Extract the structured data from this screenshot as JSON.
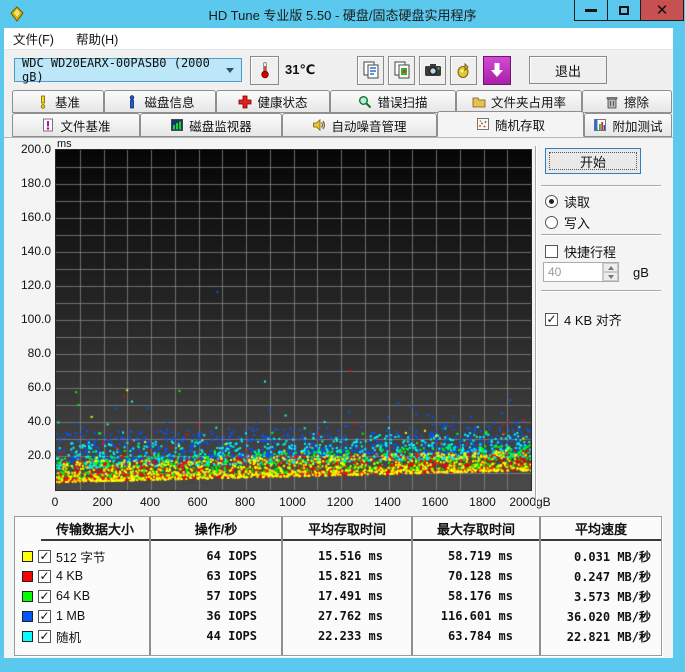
{
  "window": {
    "title": "HD Tune 专业版 5.50 - 硬盘/固态硬盘实用程序"
  },
  "menu": {
    "items": [
      "文件(F)",
      "帮助(H)"
    ]
  },
  "toolbar": {
    "drive": "WDC WD20EARX-00PASB0 (2000 gB)",
    "temperature": "31℃",
    "exit": "退出"
  },
  "tabs": {
    "row1": [
      {
        "label": "基准"
      },
      {
        "label": "磁盘信息"
      },
      {
        "label": "健康状态"
      },
      {
        "label": "错误扫描"
      },
      {
        "label": "文件夹占用率"
      },
      {
        "label": "擦除"
      }
    ],
    "row2": [
      {
        "label": "文件基准"
      },
      {
        "label": "磁盘监视器"
      },
      {
        "label": "自动噪音管理"
      },
      {
        "label": "随机存取"
      },
      {
        "label": "附加测试"
      }
    ],
    "active": "随机存取"
  },
  "panel": {
    "start": "开始",
    "read": "读取",
    "read_selected": true,
    "write": "写入",
    "write_selected": false,
    "short_stroke": "快捷行程",
    "short_stroke_checked": false,
    "short_stroke_value": "40",
    "short_stroke_unit": "gB",
    "align": "4 KB 对齐",
    "align_checked": true
  },
  "table": {
    "headers": [
      "传输数据大小",
      "操作/秒",
      "平均存取时间",
      "最大存取时间",
      "平均速度"
    ]
  },
  "chart_data": {
    "type": "scatter",
    "title": "",
    "xlabel": "gB",
    "ylabel": "ms",
    "xlim": [
      0,
      2000
    ],
    "ylim": [
      0,
      200
    ],
    "x_tick_values": [
      0,
      200,
      400,
      600,
      800,
      1000,
      1200,
      1400,
      1600,
      1800,
      2000
    ],
    "x_tick_labels": [
      "0",
      "200",
      "400",
      "600",
      "800",
      "1000",
      "1200",
      "1400",
      "1600",
      "1800",
      "2000gB"
    ],
    "y_tick_values": [
      20,
      40,
      60,
      80,
      100,
      120,
      140,
      160,
      180,
      200
    ],
    "x_grid_step": 100,
    "y_grid_step": 10,
    "grid": true,
    "legend_position": "bottom-table",
    "bg_top": "#060606",
    "bg_bottom": "#4a4a4a",
    "grid_color": "#8a8a8a",
    "draw_order": [
      3,
      4,
      2,
      1,
      0
    ],
    "series": [
      {
        "label": "512 字节",
        "color": "#ffff00",
        "checked": true,
        "iops": "64 IOPS",
        "avg_access": "15.516 ms",
        "max_access": "58.719 ms",
        "avg_speed": "0.031 MB/秒",
        "gen": {
          "seed": 11,
          "count": 1000,
          "base": 4.5,
          "rise": 7,
          "noise": 12,
          "tail_chance": 0.02,
          "tail": 22,
          "extra": [
            [
              300,
              58.7
            ],
            [
              150,
              43
            ]
          ]
        }
      },
      {
        "label": "4 KB",
        "color": "#ff0000",
        "checked": true,
        "iops": "63 IOPS",
        "avg_access": "15.821 ms",
        "max_access": "70.128 ms",
        "avg_speed": "0.247 MB/秒",
        "gen": {
          "seed": 22,
          "count": 1000,
          "base": 4.8,
          "rise": 7,
          "noise": 12,
          "tail_chance": 0.03,
          "tail": 24,
          "extra": [
            [
              1240,
              70.1
            ],
            [
              285,
              55
            ]
          ]
        }
      },
      {
        "label": "64 KB",
        "color": "#00ff00",
        "checked": true,
        "iops": "57 IOPS",
        "avg_access": "17.491 ms",
        "max_access": "58.176 ms",
        "avg_speed": "3.573 MB/秒",
        "gen": {
          "seed": 33,
          "count": 950,
          "base": 6,
          "rise": 7.5,
          "noise": 13,
          "tail_chance": 0.03,
          "tail": 20,
          "extra": [
            [
              85,
              57.5
            ],
            [
              520,
              58.2
            ],
            [
              95,
              50
            ]
          ]
        }
      },
      {
        "label": "1 MB",
        "color": "#0055ff",
        "checked": true,
        "iops": "36 IOPS",
        "avg_access": "27.762 ms",
        "max_access": "116.601 ms",
        "avg_speed": "36.020 MB/秒",
        "gen": {
          "seed": 44,
          "count": 800,
          "base": 16.5,
          "rise": 7,
          "noise": 17,
          "tail_chance": 0.06,
          "tail": 22,
          "extra": [
            [
              680,
              116.6
            ],
            [
              250,
              48
            ],
            [
              1500,
              49
            ],
            [
              900,
              47
            ]
          ]
        }
      },
      {
        "label": "随机",
        "color": "#00ffff",
        "checked": true,
        "iops": "44 IOPS",
        "avg_access": "22.233 ms",
        "max_access": "63.784 ms",
        "avg_speed": "22.821 MB/秒",
        "gen": {
          "seed": 55,
          "count": 850,
          "base": 12.5,
          "rise": 7,
          "noise": 15,
          "tail_chance": 0.04,
          "tail": 18,
          "extra": [
            [
              880,
              63.8
            ],
            [
              320,
              52
            ]
          ]
        }
      }
    ]
  }
}
